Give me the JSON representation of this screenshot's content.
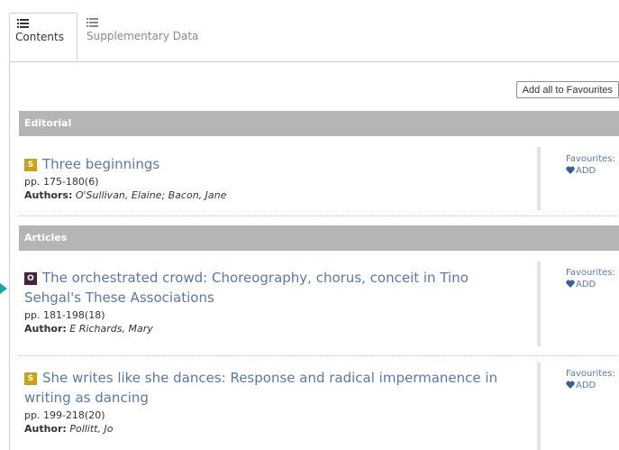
{
  "tabs": [
    {
      "label": "Contents",
      "icon": "list-icon",
      "active": true
    },
    {
      "label": "Supplementary Data",
      "icon": "list-icon",
      "active": false
    }
  ],
  "toolbar": {
    "add_all_label": "Add all to Favourites"
  },
  "sections": [
    {
      "header": "Editorial",
      "items": [
        {
          "badge": "S",
          "title_line1": "Three beginnings",
          "title_line2": "",
          "pages": "pp. 175-180(6)",
          "author_label": "Authors:",
          "author_names": "O'Sullivan, Elaine; Bacon, Jane",
          "fav_label": "Favourites:",
          "fav_add": "ADD"
        }
      ]
    },
    {
      "header": "Articles",
      "items": [
        {
          "badge": "O",
          "title_line1": "The orchestrated crowd: Choreography, chorus, conceit in Tino",
          "title_line2": "Sehgal's These Associations",
          "pages": "pp. 181-198(18)",
          "author_label": "Author:",
          "author_names": "E Richards, Mary",
          "fav_label": "Favourites:",
          "fav_add": "ADD"
        },
        {
          "badge": "S",
          "title_line1": "She writes like she dances: Response and radical impermanence in",
          "title_line2": "writing as dancing",
          "pages": "pp. 199-218(20)",
          "author_label": "Author:",
          "author_names": "Pollitt, Jo",
          "fav_label": "Favourites:",
          "fav_add": "ADD"
        }
      ]
    }
  ],
  "colors": {
    "link": "#5a79a8",
    "badge_s": "#c9a11a",
    "badge_o": "#4a2040",
    "section_bg": "#b5b5b5"
  }
}
